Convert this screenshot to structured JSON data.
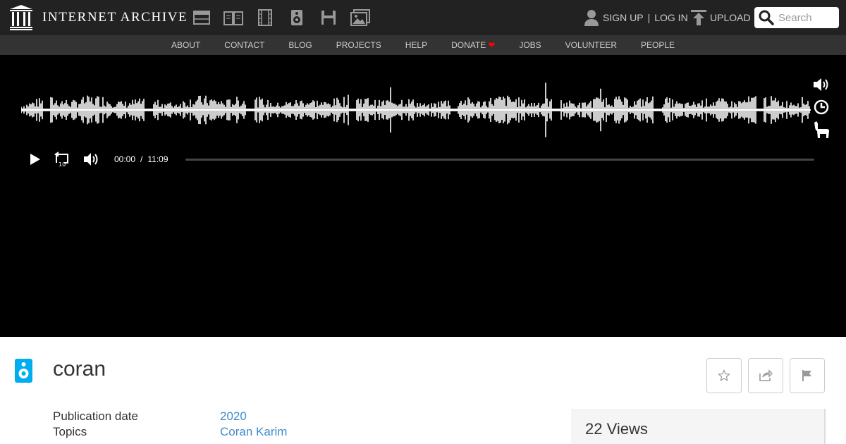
{
  "header": {
    "logo_text": "INTERNET ARCHIVE",
    "media_icons": [
      "web-icon",
      "texts-icon",
      "video-icon",
      "audio-icon",
      "software-icon",
      "images-icon"
    ],
    "sign_up": "SIGN UP",
    "separator": "|",
    "log_in": "LOG IN",
    "upload": "UPLOAD",
    "search_placeholder": "Search"
  },
  "subnav": {
    "items": [
      "ABOUT",
      "CONTACT",
      "BLOG",
      "PROJECTS",
      "HELP",
      "DONATE",
      "JOBS",
      "VOLUNTEER",
      "PEOPLE"
    ],
    "donate_heart": "❤"
  },
  "player": {
    "current_time": "00:00",
    "time_separator": "/",
    "duration": "11:09",
    "progress": 0,
    "side_tools": [
      "volume-icon",
      "clock-icon",
      "llama-icon"
    ]
  },
  "item": {
    "title": "coran",
    "metadata": [
      {
        "key": "Publication date",
        "value": "2020"
      },
      {
        "key": "Topics",
        "value": "Coran Karim"
      }
    ],
    "views": "22 Views",
    "actions": [
      "favorite-icon",
      "share-icon",
      "flag-icon"
    ]
  },
  "colors": {
    "topbar": "#222222",
    "subnav": "#333333",
    "link": "#428bca",
    "audio_icon": "#00adef",
    "heart": "#ff0000"
  }
}
